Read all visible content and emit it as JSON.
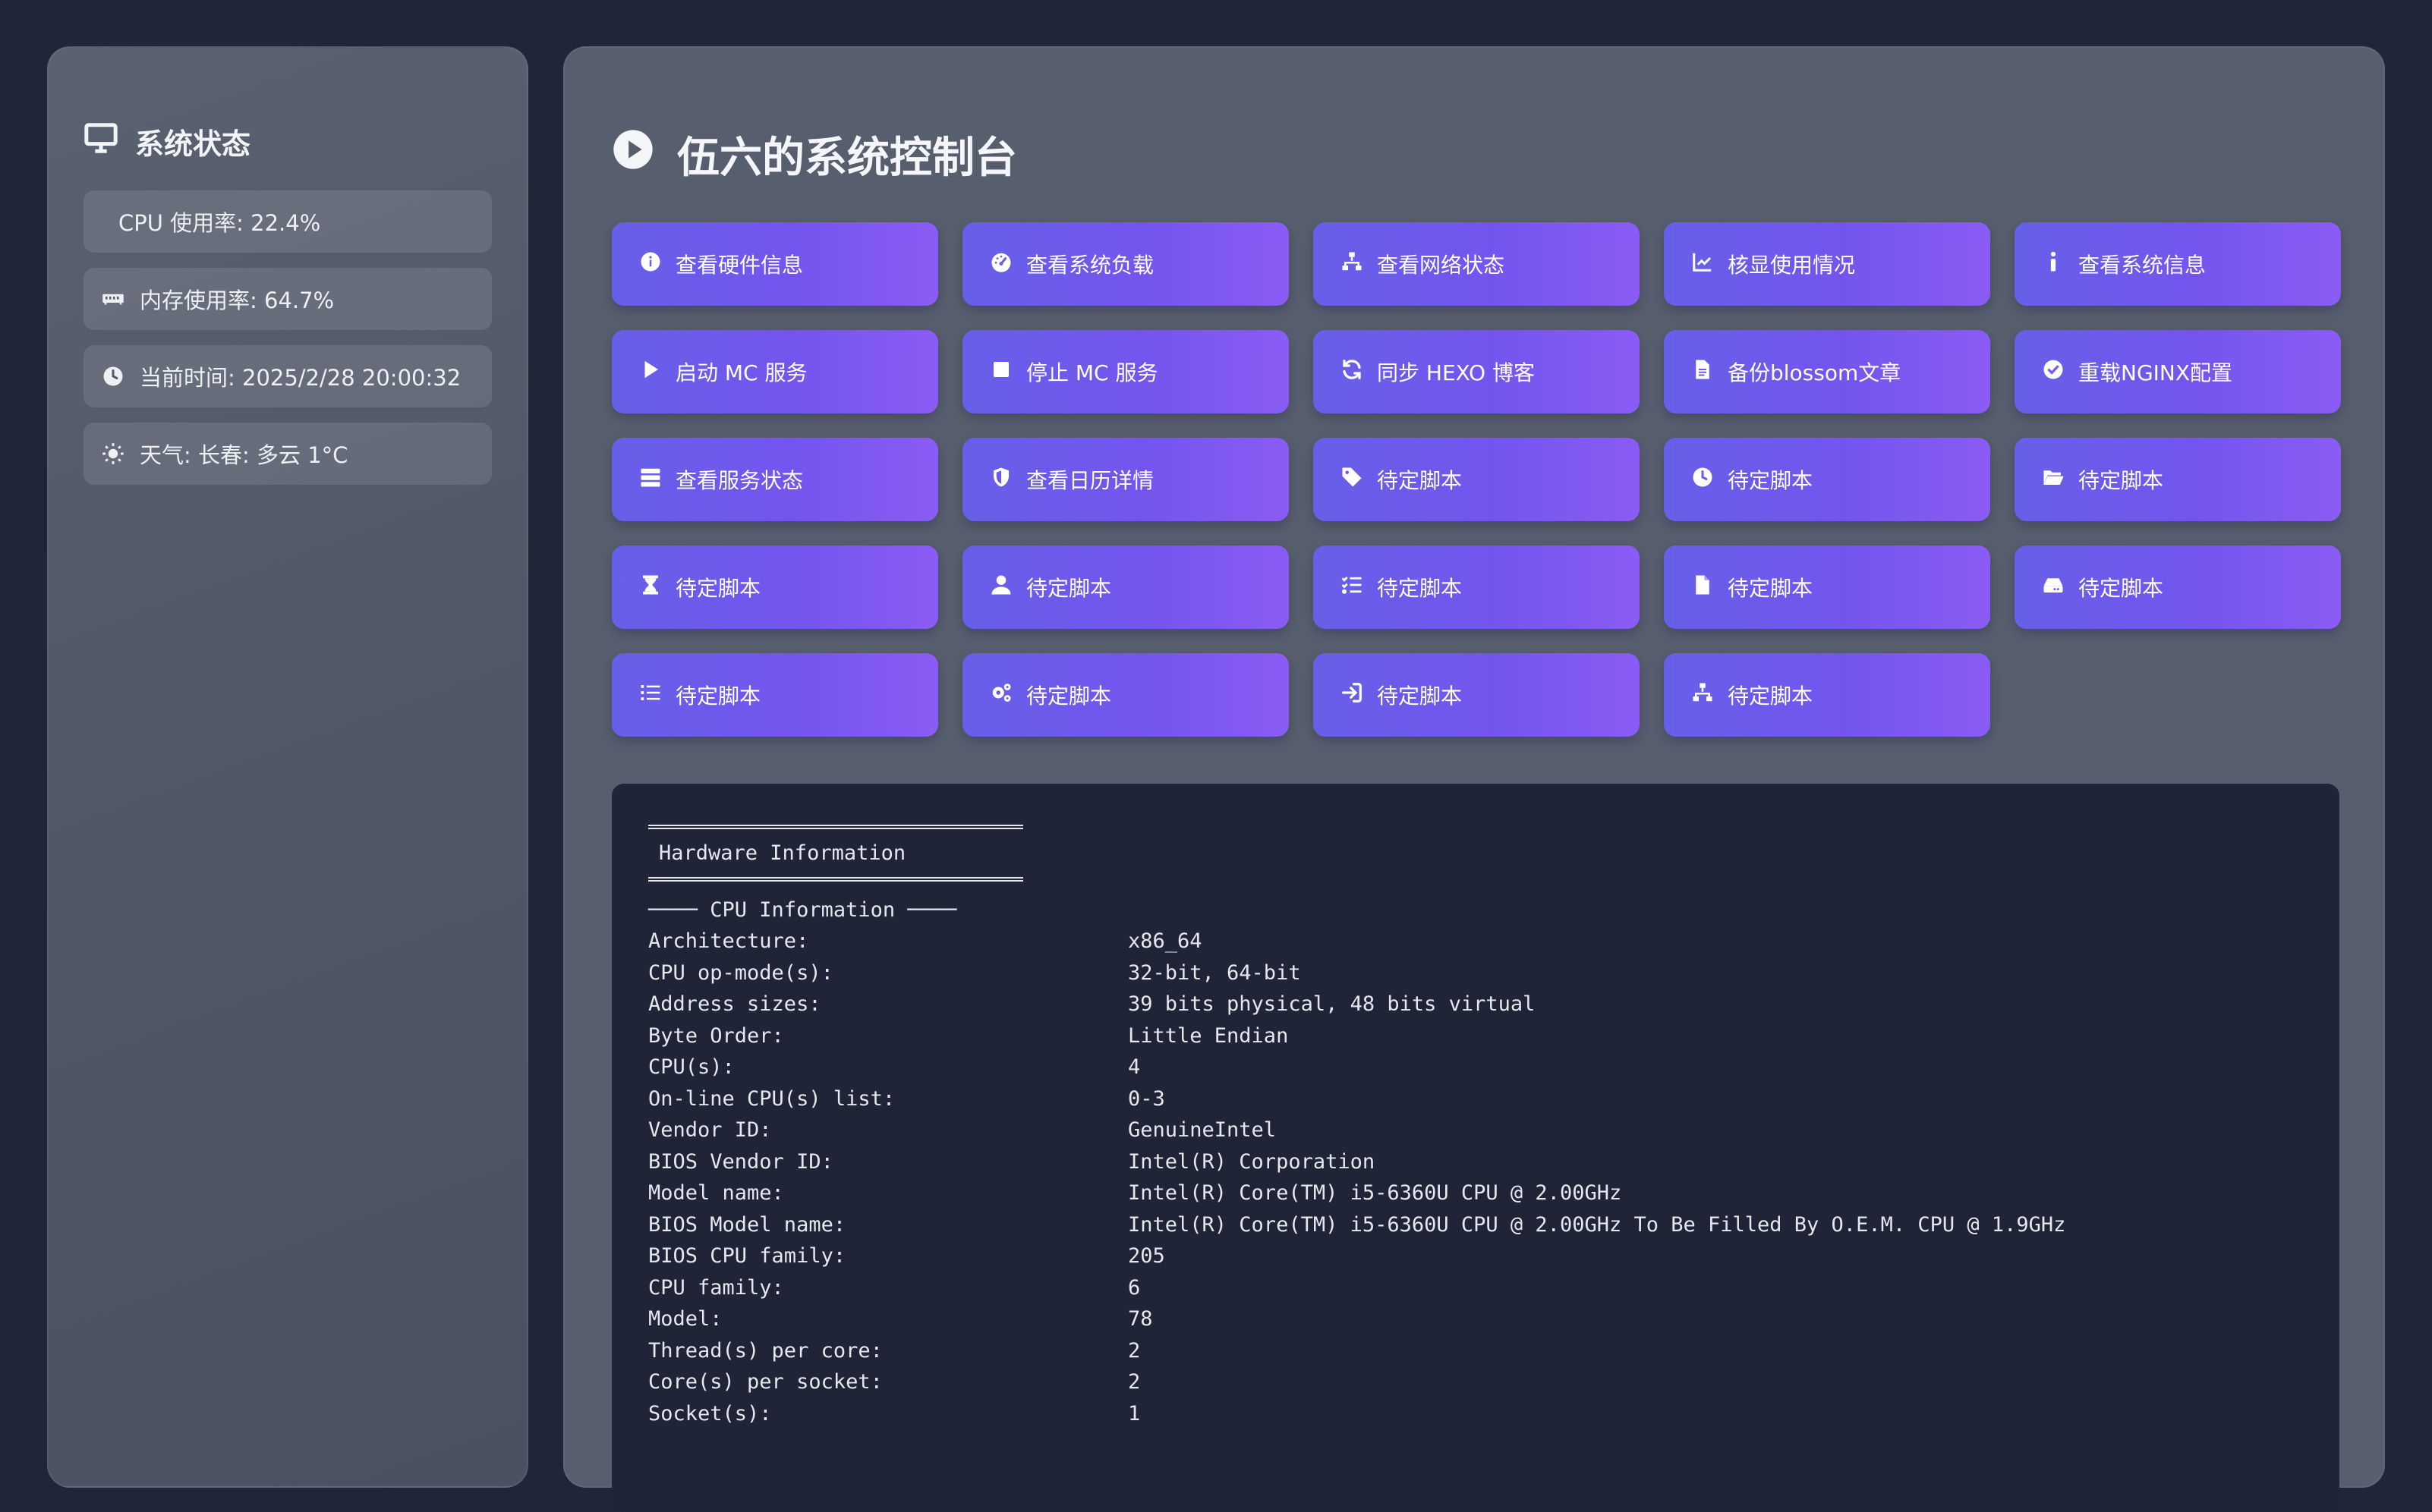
{
  "sidebar": {
    "title": "系统状态",
    "stats": [
      {
        "icon": "none",
        "text": "CPU 使用率: 22.4%"
      },
      {
        "icon": "memory-icon",
        "text": "内存使用率: 64.7%"
      },
      {
        "icon": "clock-icon",
        "text": "当前时间: 2025/2/28 20:00:32"
      },
      {
        "icon": "sun-icon",
        "text": "天气: 长春: 多云 1°C"
      }
    ]
  },
  "main": {
    "title": "伍六的系统控制台",
    "buttons": [
      {
        "icon": "info-circle-icon",
        "label": "查看硬件信息"
      },
      {
        "icon": "gauge-icon",
        "label": "查看系统负载"
      },
      {
        "icon": "network-icon",
        "label": "查看网络状态"
      },
      {
        "icon": "chart-line-icon",
        "label": "核显使用情况"
      },
      {
        "icon": "info-icon",
        "label": "查看系统信息"
      },
      {
        "icon": "play-icon",
        "label": "启动 MC 服务"
      },
      {
        "icon": "stop-icon",
        "label": "停止 MC 服务"
      },
      {
        "icon": "sync-icon",
        "label": "同步 HEXO 博客"
      },
      {
        "icon": "file-icon",
        "label": "备份blossom文章"
      },
      {
        "icon": "check-circle-icon",
        "label": "重载NGINX配置"
      },
      {
        "icon": "server-icon",
        "label": "查看服务状态"
      },
      {
        "icon": "shield-icon",
        "label": "查看日历详情"
      },
      {
        "icon": "tag-icon",
        "label": "待定脚本"
      },
      {
        "icon": "clock-icon",
        "label": "待定脚本"
      },
      {
        "icon": "folder-open-icon",
        "label": "待定脚本"
      },
      {
        "icon": "hourglass-icon",
        "label": "待定脚本"
      },
      {
        "icon": "user-icon",
        "label": "待定脚本"
      },
      {
        "icon": "list-check-icon",
        "label": "待定脚本"
      },
      {
        "icon": "file-icon",
        "label": "待定脚本"
      },
      {
        "icon": "hdd-icon",
        "label": "待定脚本"
      },
      {
        "icon": "list-icon",
        "label": "待定脚本"
      },
      {
        "icon": "cogs-icon",
        "label": "待定脚本"
      },
      {
        "icon": "sign-in-icon",
        "label": "待定脚本"
      },
      {
        "icon": "network-icon",
        "label": "待定脚本"
      }
    ]
  },
  "terminal": {
    "header": "Hardware Information",
    "section": "──── CPU Information ────",
    "rows": [
      {
        "key": "Architecture:",
        "value": "x86_64"
      },
      {
        "key": "CPU op-mode(s):",
        "value": "32-bit, 64-bit"
      },
      {
        "key": "Address sizes:",
        "value": "39 bits physical, 48 bits virtual"
      },
      {
        "key": "Byte Order:",
        "value": "Little Endian"
      },
      {
        "key": "CPU(s):",
        "value": "4"
      },
      {
        "key": "On-line CPU(s) list:",
        "value": "0-3"
      },
      {
        "key": "Vendor ID:",
        "value": "GenuineIntel"
      },
      {
        "key": "BIOS Vendor ID:",
        "value": "Intel(R) Corporation"
      },
      {
        "key": "Model name:",
        "value": "Intel(R) Core(TM) i5-6360U CPU @ 2.00GHz"
      },
      {
        "key": "BIOS Model name:",
        "value": "Intel(R) Core(TM) i5-6360U CPU @ 2.00GHz To Be Filled By O.E.M. CPU @ 1.9GHz"
      },
      {
        "key": "BIOS CPU family:",
        "value": "205"
      },
      {
        "key": "CPU family:",
        "value": "6"
      },
      {
        "key": "Model:",
        "value": "78"
      },
      {
        "key": "Thread(s) per core:",
        "value": "2"
      },
      {
        "key": "Core(s) per socket:",
        "value": "2"
      },
      {
        "key": "Socket(s):",
        "value": "1"
      }
    ]
  }
}
